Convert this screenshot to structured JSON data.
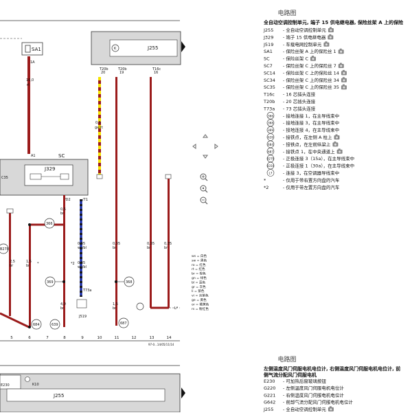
{
  "page_header": "电路图",
  "legend": {
    "title": "全自动空调控制单元, 端子 15 供电继电器, 保险丝架 A 上的保险",
    "items": [
      {
        "code": "J255",
        "text": "全自动空调控制单元",
        "cam": true
      },
      {
        "code": "J329",
        "text": "端子 15 供电继电器",
        "cam": true
      },
      {
        "code": "J519",
        "text": "车载电网控制单元",
        "cam": true
      },
      {
        "code": "SA1",
        "text": "保险丝架 A 上的保险丝 1",
        "cam": true
      },
      {
        "code": "SC",
        "text": "保险丝架 C",
        "cam": true
      },
      {
        "code": "SC7",
        "text": "保险丝架 C 上的保险丝 7",
        "cam": true
      },
      {
        "code": "SC14",
        "text": "保险丝架 C 上的保险丝 14",
        "cam": true
      },
      {
        "code": "SC34",
        "text": "保险丝架 C 上的保险丝 34",
        "cam": true
      },
      {
        "code": "SC35",
        "text": "保险丝架 C 上的保险丝 35",
        "cam": true
      },
      {
        "code": "T16c",
        "text": "16 芯插头连接",
        "cam": false
      },
      {
        "code": "T20b",
        "text": "20 芯插头连接",
        "cam": false
      },
      {
        "code": "T73a",
        "text": "73 芯插头连接",
        "cam": false
      },
      {
        "code": "366",
        "text": "接地连接 1，在主导线束中",
        "cam": false,
        "circle": true
      },
      {
        "code": "368",
        "text": "接地连接 3，在主导线束中",
        "cam": false,
        "circle": true
      },
      {
        "code": "369",
        "text": "接地连接 4，在主导线束中",
        "cam": false,
        "circle": true
      },
      {
        "code": "639",
        "text": "接铁点，在左侧 A 柱上",
        "cam": true,
        "circle": true
      },
      {
        "code": "684",
        "text": "接铁点，在左前纵梁上",
        "cam": true,
        "circle": true
      },
      {
        "code": "687",
        "text": "接铁点 1，在中央通道上",
        "cam": true,
        "circle": true
      },
      {
        "code": "B278",
        "text": "正极连接 3（15a），在主导线束中",
        "cam": false,
        "circle": true
      },
      {
        "code": "B316",
        "text": "正极连接 1（30a），在主导线束中",
        "cam": false,
        "circle": true
      },
      {
        "code": "L7",
        "text": "连接 3，在空调器导线束中",
        "cam": false,
        "circle": true
      },
      {
        "code": "*",
        "text": "仅用于带右置方向盘的汽车",
        "cam": false
      },
      {
        "code": "*2",
        "text": "仅用于带左置方向盘的汽车",
        "cam": false
      }
    ]
  },
  "diagram": {
    "fuse_sa1": "SA1",
    "j255_label": "J255",
    "j329_label": "J329",
    "j519_label": "J519",
    "sc_label": "SC",
    "sc35_label": "C35",
    "sa1_pin": "1A",
    "j329_pin_a1": "A1",
    "wire_main_size": "16,0",
    "wire_main_color": "rt",
    "t20b_20": "T20b\n20",
    "t20b_19": "T20b\n19",
    "t16c_16": "T16c\n16",
    "wire_gerot_size": "0,5",
    "wire_gerot_color": "ge/rt",
    "t73a_label": "T73a",
    "t73a_pin": "/71",
    "pin_d2": "/D2",
    "pin_71": "/71",
    "conn_l7": "L7",
    "conn_l7b": "L*",
    "footer_code": "97-0...14/05/11/14",
    "ground_366": "366",
    "ground_368": "368",
    "ground_369": "369",
    "ground_684": "684",
    "ground_639": "639",
    "ground_687": "687",
    "b278": "B278",
    "star": "*",
    "star2": "*2",
    "column_numbers": [
      "5",
      "6",
      "7",
      "8",
      "9",
      "10",
      "11",
      "12",
      "13",
      "14"
    ],
    "wire_labels": [
      {
        "id": "w6a",
        "text": "2,5\nbr"
      },
      {
        "id": "w6b",
        "text": "1,5\nbr"
      },
      {
        "id": "w8a",
        "text": "0,5\nbr"
      },
      {
        "id": "w8b",
        "text": "4,0\nbr"
      },
      {
        "id": "w9a",
        "text": "0,35\nws/bl"
      },
      {
        "id": "w9b",
        "text": "0,35\nws/bl"
      },
      {
        "id": "w11a",
        "text": "0,35\nbr"
      },
      {
        "id": "w11b",
        "text": "1,5\nbr"
      },
      {
        "id": "w13a",
        "text": "0,35\nbr"
      },
      {
        "id": "w14a",
        "text": "0,35\nbr"
      }
    ],
    "color_key": [
      "ws = 白色",
      "sw = 黑色",
      "ro = 红色",
      "rt = 红色",
      "br = 棕色",
      "gn = 绿色",
      "bl = 蓝色",
      "gr = 灰色",
      "li = 紫色",
      "vi = 淡紫色",
      "ge = 黄色",
      "or = 橘黄色",
      "rs = 粉红色"
    ]
  },
  "lower_panel": {
    "title_line1": "左侧温度风门伺服电机电位计, 右侧温度风门伺服电机电位计, 前",
    "title_line2": "侧气流分配风门伺服电机",
    "e230_label": "E230",
    "k10_label": "K10",
    "j255_label": "J255",
    "items": [
      {
        "code": "E230",
        "text": "可加热后窗玻璃按钮",
        "cam": false
      },
      {
        "code": "G220",
        "text": "左侧温度风门伺服电机电位计",
        "cam": false
      },
      {
        "code": "G221",
        "text": "右侧温度风门伺服电机电位计",
        "cam": false
      },
      {
        "code": "G642",
        "text": "前部气流分配风门伺服电机电位计",
        "cam": false
      },
      {
        "code": "J255",
        "text": "全自动空调控制单元",
        "cam": true
      }
    ]
  },
  "nav": {
    "up": "^",
    "down": "v",
    "left": "<",
    "right": ">"
  },
  "colors": {
    "wire_red": "#9b1b1b",
    "wire_blue": "#1a2ea8",
    "wire_yellow": "#f5e200",
    "box_fill": "#d8d8d8",
    "box_stroke": "#333333"
  }
}
